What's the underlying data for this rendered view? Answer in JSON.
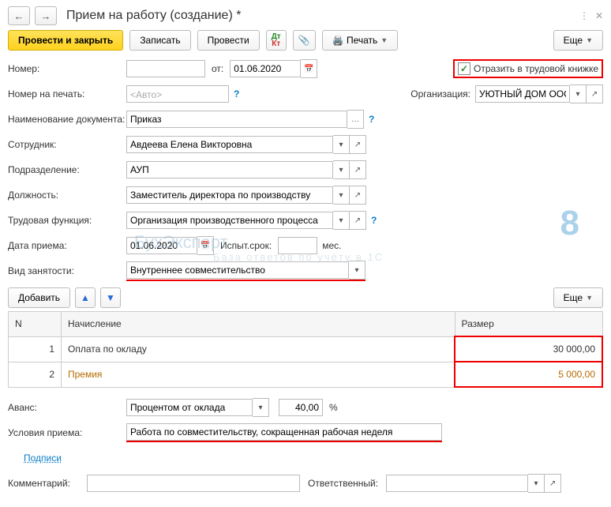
{
  "title": "Прием на работу (создание) *",
  "toolbar": {
    "post_close": "Провести и закрыть",
    "save": "Записать",
    "post": "Провести",
    "print": "Печать",
    "more": "Еще"
  },
  "reflect_label": "Отразить в трудовой книжке",
  "fields": {
    "number_lbl": "Номер:",
    "from_lbl": "от:",
    "from_val": "01.06.2020",
    "print_num_lbl": "Номер на печать:",
    "print_num_ph": "<Авто>",
    "org_lbl": "Организация:",
    "org_val": "УЮТНЫЙ ДОМ ООО",
    "docname_lbl": "Наименование документа:",
    "docname_val": "Приказ",
    "employee_lbl": "Сотрудник:",
    "employee_val": "Авдеева Елена Викторовна",
    "dept_lbl": "Подразделение:",
    "dept_val": "АУП",
    "position_lbl": "Должность:",
    "position_val": "Заместитель директора по производству",
    "func_lbl": "Трудовая функция:",
    "func_val": "Организация производственного процесса",
    "date_lbl": "Дата приема:",
    "date_val": "01.06.2020",
    "probation_lbl": "Испыт.срок:",
    "probation_unit": "мес.",
    "employment_lbl": "Вид занятости:",
    "employment_val": "Внутреннее совместительство",
    "add_btn": "Добавить",
    "more2": "Еще",
    "advance_lbl": "Аванс:",
    "advance_type": "Процентом от оклада",
    "advance_pct": "40,00",
    "pct_sign": "%",
    "conditions_lbl": "Условия приема:",
    "conditions_val": "Работа по совместительству, сокращенная рабочая неделя",
    "signatures": "Подписи",
    "comment_lbl": "Комментарий:",
    "responsible_lbl": "Ответственный:"
  },
  "table": {
    "col_n": "N",
    "col_accrual": "Начисление",
    "col_size": "Размер",
    "rows": [
      {
        "n": "1",
        "name": "Оплата по окладу",
        "size": "30 000,00"
      },
      {
        "n": "2",
        "name": "Премия",
        "size": "5 000,00"
      }
    ]
  },
  "watermark": {
    "a": "БухЭксперт",
    "b": "База ответов по учёту в 1С",
    "c": "8"
  }
}
